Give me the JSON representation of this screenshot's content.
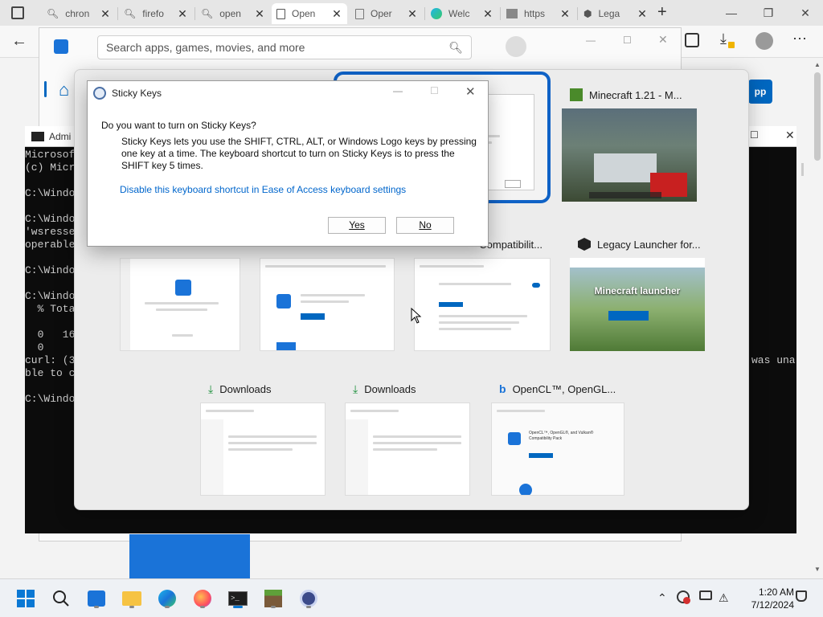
{
  "browser": {
    "tabs": [
      {
        "label": "chron",
        "icon": "search-icon",
        "active": false
      },
      {
        "label": "firefo",
        "icon": "search-icon",
        "active": false
      },
      {
        "label": "open",
        "icon": "search-icon",
        "active": false
      },
      {
        "label": "Open",
        "icon": "document-icon",
        "active": true
      },
      {
        "label": "Oper",
        "icon": "document-icon",
        "active": false
      },
      {
        "label": "Welc",
        "icon": "edge-icon",
        "active": false
      },
      {
        "label": "https",
        "icon": "image-icon",
        "active": false
      },
      {
        "label": "Lega",
        "icon": "cube-icon",
        "active": false
      }
    ],
    "new_tab_glyph": "+",
    "minimize_glyph": "—",
    "restore_glyph": "❐",
    "close_glyph": "✕"
  },
  "store": {
    "search_placeholder": "Search apps, games, movies, and more",
    "partial_button": "pp"
  },
  "cmd": {
    "title": "Admi",
    "lines": [
      "Microsof",
      "(c) Micr",
      "",
      "C:\\Windo",
      "",
      "C:\\Windo",
      "'wsresse",
      "operable",
      "",
      "C:\\Windo",
      "",
      "C:\\Windo",
      "  % Tota",
      "",
      "  0   16",
      "  0",
      "curl: (3",
      "ble to c",
      "",
      "C:\\Windo"
    ],
    "right_text": "was una"
  },
  "switcher": {
    "thumbnails": [
      {
        "title": "",
        "icon": "edge-icon"
      },
      {
        "title": "Minecraft 1.21 - M...",
        "icon": "minecraft-icon"
      },
      {
        "title": "",
        "icon": "edge-icon"
      },
      {
        "title": "",
        "icon": "edge-icon"
      },
      {
        "title": "Compatibilit...",
        "icon": "edge-icon"
      },
      {
        "title": "Legacy Launcher for...",
        "icon": "cube-icon"
      },
      {
        "title": "Downloads",
        "icon": "download-icon"
      },
      {
        "title": "Downloads",
        "icon": "download-icon"
      },
      {
        "title": "OpenCL™, OpenGL...",
        "icon": "bing-icon"
      }
    ],
    "preview_text": {
      "opencl_title": "OpenCL™, OpenGL®, and Vulkan® Compatibility Pack",
      "minecraft_launcher": "Minecraft launcher"
    }
  },
  "sticky_keys": {
    "title": "Sticky Keys",
    "question": "Do you want to turn on Sticky Keys?",
    "body": "Sticky Keys lets you use the SHIFT, CTRL, ALT, or Windows Logo keys by pressing one key at a time. The keyboard shortcut to turn on Sticky Keys is to press the SHIFT key 5 times.",
    "link": "Disable this keyboard shortcut in Ease of Access keyboard settings",
    "yes": "Yes",
    "no": "No"
  },
  "taskbar": {
    "time": "1:20 AM",
    "date": "7/12/2024",
    "apps": [
      "windows-start-icon",
      "search-icon",
      "store-icon",
      "file-explorer-icon",
      "edge-icon",
      "firefox-icon",
      "terminal-icon",
      "minecraft-icon",
      "settings-icon"
    ]
  },
  "colors": {
    "accent": "#0067c0",
    "link": "#0066cc",
    "switcher_focus": "#0f62c6"
  }
}
